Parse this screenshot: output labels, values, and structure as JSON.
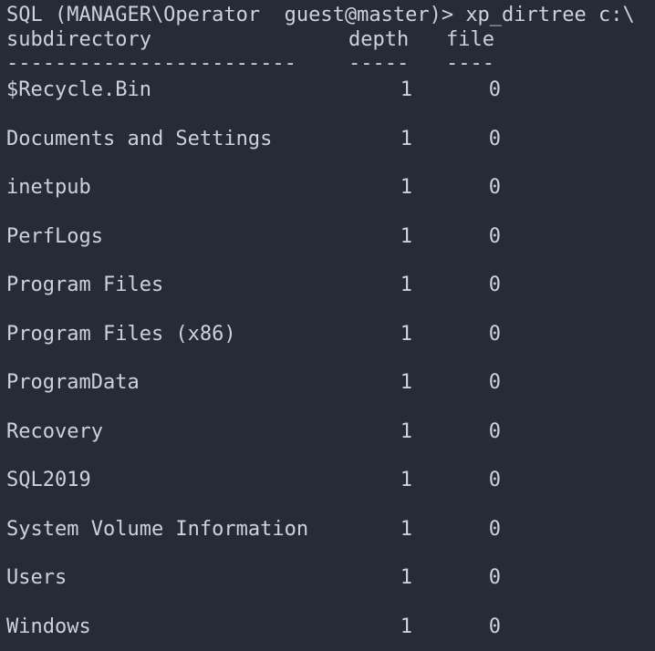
{
  "prompt": {
    "text": "SQL (MANAGER\\Operator  guest@master)> xp_dirtree c:\\"
  },
  "table": {
    "headers": {
      "subdirectory": "subdirectory",
      "depth": "depth",
      "file": "file"
    },
    "separators": {
      "subdirectory": "------------------------",
      "depth": "-----",
      "file": "----"
    },
    "rows": [
      {
        "subdirectory": "$Recycle.Bin",
        "depth": "1",
        "file": "0"
      },
      {
        "subdirectory": "Documents and Settings",
        "depth": "1",
        "file": "0"
      },
      {
        "subdirectory": "inetpub",
        "depth": "1",
        "file": "0"
      },
      {
        "subdirectory": "PerfLogs",
        "depth": "1",
        "file": "0"
      },
      {
        "subdirectory": "Program Files",
        "depth": "1",
        "file": "0"
      },
      {
        "subdirectory": "Program Files (x86)",
        "depth": "1",
        "file": "0"
      },
      {
        "subdirectory": "ProgramData",
        "depth": "1",
        "file": "0"
      },
      {
        "subdirectory": "Recovery",
        "depth": "1",
        "file": "0"
      },
      {
        "subdirectory": "SQL2019",
        "depth": "1",
        "file": "0"
      },
      {
        "subdirectory": "System Volume Information",
        "depth": "1",
        "file": "0"
      },
      {
        "subdirectory": "Users",
        "depth": "1",
        "file": "0"
      },
      {
        "subdirectory": "Windows",
        "depth": "1",
        "file": "0"
      }
    ]
  },
  "colors": {
    "background": "#262b37",
    "foreground": "#cdd2da"
  }
}
